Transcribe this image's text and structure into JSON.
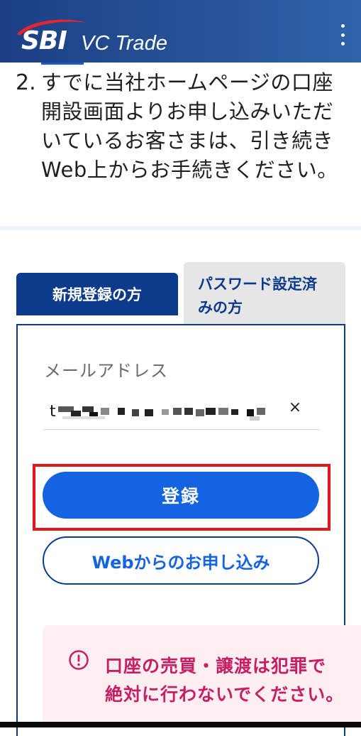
{
  "header": {
    "logo_sbi": "SBI",
    "logo_product": "VC Trade",
    "menu_icon": "more-vertical-icon",
    "background_colors": [
      "#1c3f84",
      "#2f63a8"
    ]
  },
  "instruction": {
    "number": "2.",
    "lines": [
      "すでに当社ホームページの口座",
      "開設画面よりお申し込みいただ",
      "いているお客さまは、引き続き",
      "Web上からお手続きください。"
    ]
  },
  "tabs": [
    {
      "label": "新規登録の方",
      "active": true
    },
    {
      "label_lines": [
        "パスワード設定済",
        "みの方"
      ],
      "active": false
    }
  ],
  "form": {
    "email_label": "メールアドレス",
    "email_value_visible": "t",
    "email_value_obscured": true,
    "clear_icon": "close-icon",
    "clear_symbol": "×",
    "register_label": "登録",
    "web_apply_label": "Webからのお申し込み"
  },
  "warning": {
    "icon": "alert-circle-icon",
    "lines": [
      "口座の売買・譲渡は犯罪で",
      "絶対に行わないでください。"
    ]
  },
  "colors": {
    "primary_navy": "#0d3b8c",
    "primary_blue": "#1463e0",
    "highlight_red": "#e0161e",
    "warning_text": "#c71f63",
    "warning_bg": "#fdeef2"
  }
}
